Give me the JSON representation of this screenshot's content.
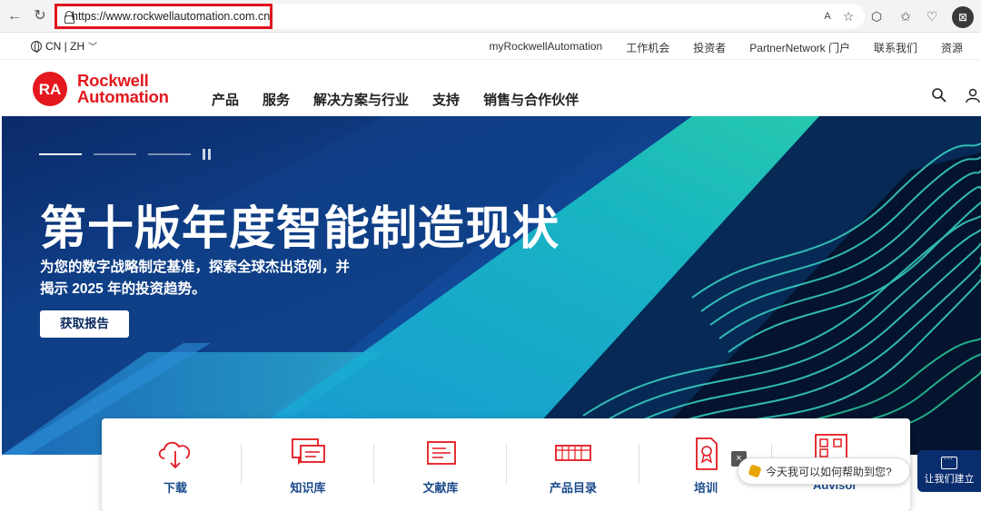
{
  "browser": {
    "url": "https://www.rockwellautomation.com.cn",
    "back_icon": "←",
    "reload_icon": "↻"
  },
  "utility": {
    "language": "CN | ZH",
    "links": [
      "myRockwellAutomation",
      "工作机会",
      "投资者",
      "PartnerNetwork 门户",
      "联系我们",
      "资源"
    ]
  },
  "brand": {
    "badge": "RA",
    "line1": "Rockwell",
    "line2": "Automation",
    "color": "#e4181e"
  },
  "mainnav": [
    "产品",
    "服务",
    "解决方案与行业",
    "支持",
    "销售与合作伙伴"
  ],
  "hero": {
    "title": "第十版年度智能制造现状",
    "subtitle_line1": "为您的数字战略制定基准，探索全球杰出范例，并",
    "subtitle_line2": "揭示 2025 年的投资趋势。",
    "cta": "获取报告"
  },
  "quicklinks": [
    {
      "label": "下载",
      "icon": "cloud-download-icon"
    },
    {
      "label": "知识库",
      "icon": "chat-bubbles-icon"
    },
    {
      "label": "文献库",
      "icon": "document-icon"
    },
    {
      "label": "产品目录",
      "icon": "catalog-icon"
    },
    {
      "label": "培训",
      "icon": "certificate-icon"
    },
    {
      "label": "Advisor",
      "icon": "grid-icon"
    }
  ],
  "chat": {
    "prompt": "今天我可以如何帮助到您?",
    "button": "让我们建立",
    "close": "×"
  }
}
